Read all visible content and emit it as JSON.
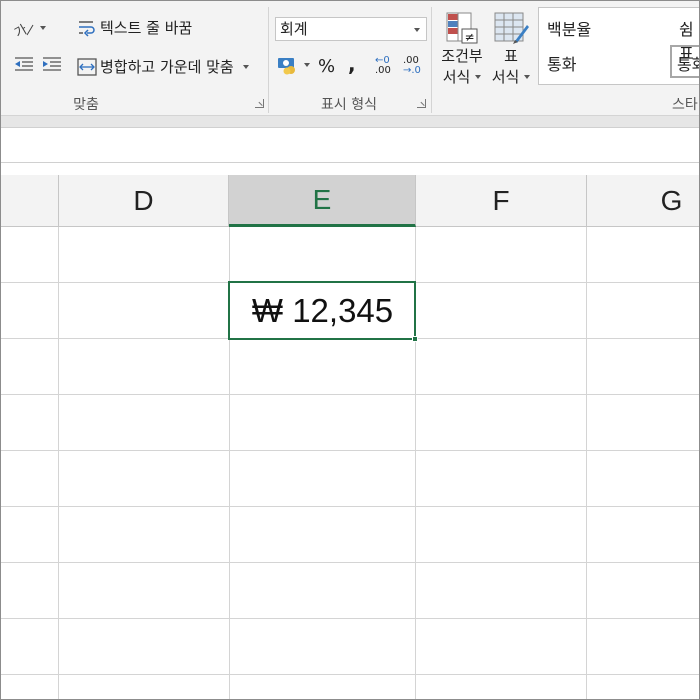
{
  "alignment": {
    "orientation_label": "가ሐ",
    "wrap_text_label": "텍스트 줄 바꿈",
    "merge_center_label": "병합하고 가운데 맞춤",
    "group_label": "맞춤"
  },
  "number": {
    "format_value": "회계",
    "percent_label": "%",
    "comma_label": ",",
    "increase_decimal_top": "←0",
    "increase_decimal_bottom": ".00",
    "decrease_decimal_top": ".00",
    "decrease_decimal_bottom": "→.0",
    "group_label": "표시 형식"
  },
  "styles": {
    "conditional_format_line1": "조건부",
    "conditional_format_line2": "서식",
    "format_table_line1": "표",
    "format_table_line2": "서식",
    "gallery_items": [
      "백분율",
      "쉼표",
      "통화",
      "통화"
    ],
    "group_label": "스타"
  },
  "columns": [
    "D",
    "E",
    "F",
    "G"
  ],
  "active_column": "E",
  "active_cell_value": "₩ 12,345",
  "colors": {
    "accent": "#217346",
    "ribbon_bg": "#f3f3f3"
  }
}
